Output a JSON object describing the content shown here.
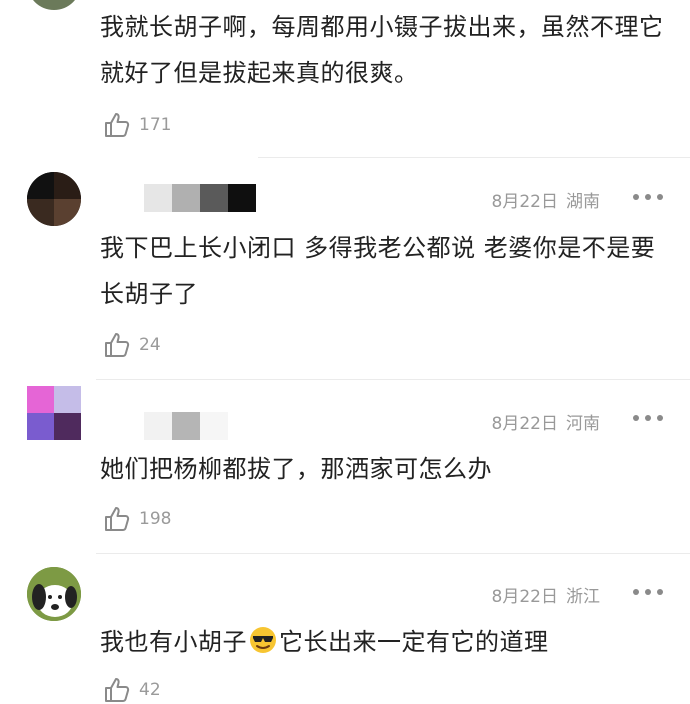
{
  "comments": [
    {
      "text": "我就长胡子啊，每周都用小镊子拔出来，虽然不理它就好了但是拔起来真的很爽。",
      "likes": "171"
    },
    {
      "date": "8月22日",
      "location": "湖南",
      "text": "我下巴上长小闭口 多得我老公都说 老婆你是不是要长胡子了",
      "likes": "24"
    },
    {
      "date": "8月22日",
      "location": "河南",
      "text": "她们把杨柳都拔了，那洒家可怎么办",
      "likes": "198"
    },
    {
      "date": "8月22日",
      "location": "浙江",
      "text_before_emoji": "我也有小胡子",
      "emoji": "sunglasses-emoji",
      "text_after_emoji": "它长出来一定有它的道理",
      "likes": "42"
    }
  ],
  "icons": {
    "like": "thumbs-up-icon",
    "more": "more-dots-icon"
  },
  "colors": {
    "text": "#222222",
    "meta": "#999999",
    "divider": "#ebebeb",
    "icon": "#8a8a8a"
  }
}
